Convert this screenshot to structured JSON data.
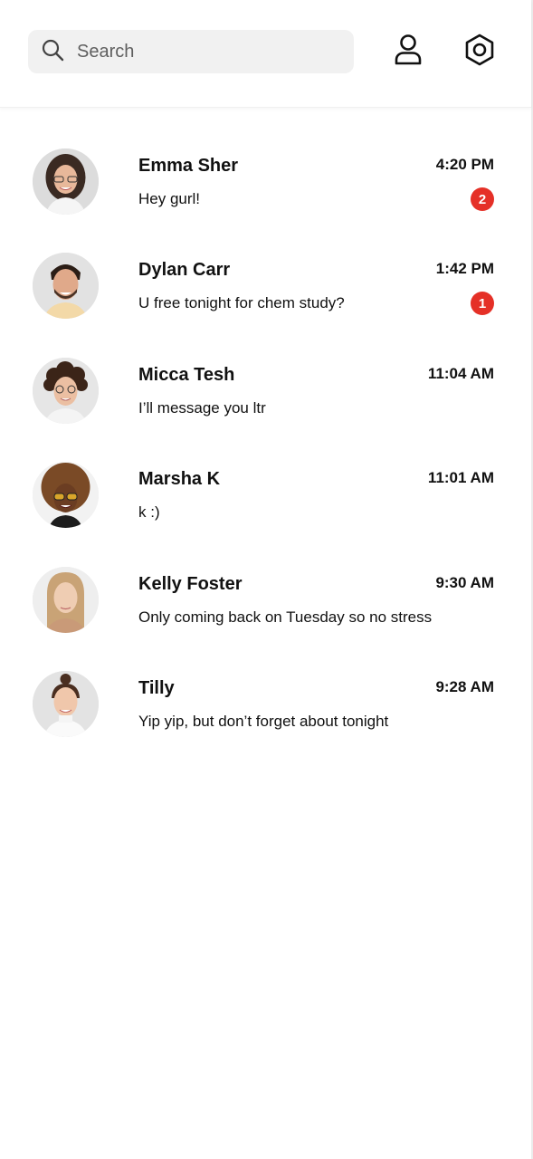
{
  "search": {
    "placeholder": "Search",
    "icon": "search-icon"
  },
  "header": {
    "profile_icon": "user-icon",
    "settings_icon": "settings-hexagon-icon"
  },
  "colors": {
    "badge": "#e53027",
    "search_bg": "#f1f1f1",
    "text": "#111111"
  },
  "conversations": [
    {
      "name": "Emma Sher",
      "message": "Hey gurl!",
      "time": "4:20 PM",
      "unread": "2"
    },
    {
      "name": "Dylan Carr",
      "message": "U free tonight for chem study?",
      "time": "1:42 PM",
      "unread": "1"
    },
    {
      "name": "Micca Tesh",
      "message": "I’ll message you ltr",
      "time": "11:04 AM",
      "unread": ""
    },
    {
      "name": "Marsha K",
      "message": "k :)",
      "time": "11:01 AM",
      "unread": ""
    },
    {
      "name": "Kelly Foster",
      "message": "Only coming back on Tuesday so no stress",
      "time": "9:30 AM",
      "unread": ""
    },
    {
      "name": "Tilly",
      "message": "Yip yip, but don’t forget about tonight",
      "time": "9:28 AM",
      "unread": ""
    }
  ]
}
